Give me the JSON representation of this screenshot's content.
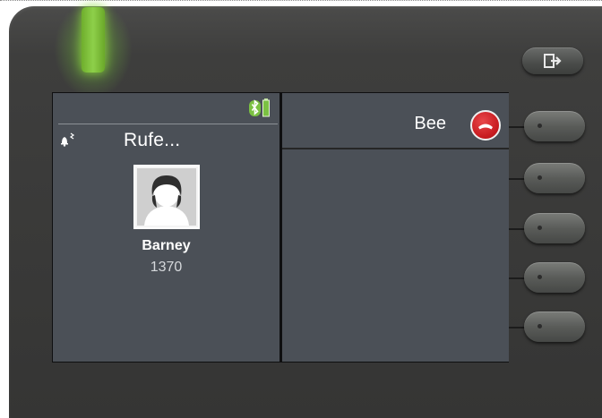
{
  "left_pane": {
    "status_text": "Rufe...",
    "contact": {
      "name": "Barney",
      "number": "1370"
    },
    "icons": {
      "bluetooth_battery": "bluetooth-battery-icon",
      "ringer_off": "ringer-off-icon",
      "avatar": "avatar-silhouette"
    }
  },
  "right_pane": {
    "caller_label": "Bee",
    "hangup_icon": "hangup-phone-icon"
  },
  "hardware": {
    "top_key_icon": "logout-icon",
    "soft_key_count": 5,
    "led_color": "#8ed04a"
  },
  "colors": {
    "pane_bg": "#4b5057",
    "hangup_red": "#c81c20",
    "device_body": "#3a3a39"
  }
}
